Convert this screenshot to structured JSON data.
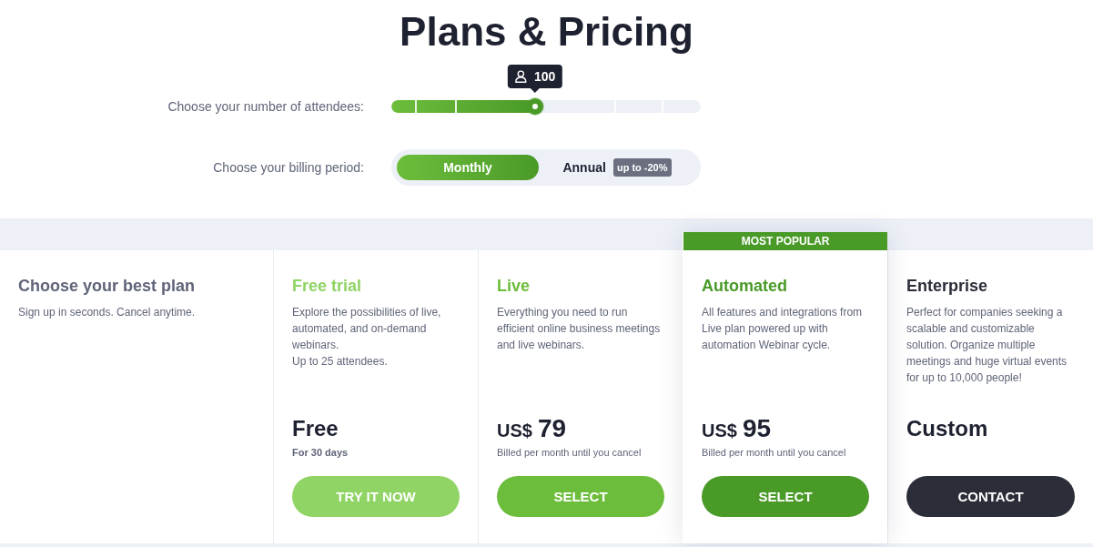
{
  "page": {
    "title": "Plans & Pricing"
  },
  "attendees": {
    "label": "Choose your number of attendees:",
    "level": 0.465,
    "value": "100"
  },
  "billing": {
    "label": "Choose your billing period:",
    "options": [
      {
        "label": "Monthly",
        "selected": true
      },
      {
        "label": "Annual",
        "selected": false,
        "badge": "up to -20%"
      }
    ]
  },
  "intro": {
    "title": "Choose your best plan",
    "subtitle": "Sign up in seconds. Cancel anytime."
  },
  "plans": [
    {
      "kind": "trial",
      "name": "Free trial",
      "color": "#8fd464",
      "featured": false,
      "description": "Explore the possibilities of live, automated, and on-demand webinars.\nUp to 25 attendees.",
      "amount": "Free",
      "note": "For 30 days",
      "button": "TRY IT NOW"
    },
    {
      "kind": "paid",
      "name": "Live",
      "color": "#6dbd3c",
      "featured": false,
      "description": "Everything you need to run efficient online business meetings and live webinars.",
      "currency": "US$",
      "amount": "79",
      "note": "Billed per month until you cancel",
      "button": "SELECT"
    },
    {
      "kind": "paid",
      "name": "Automated",
      "color": "#4a9a28",
      "featured": true,
      "ribbon": "MOST POPULAR",
      "description": "All features and integrations from Live plan powered up with automation Webinar cycle.",
      "currency": "US$",
      "amount": "95",
      "note": "Billed per month until you cancel",
      "button": "SELECT"
    },
    {
      "kind": "custom",
      "name": "Enterprise",
      "color": "#2b2e38",
      "featured": false,
      "description": "Perfect for companies seeking a scalable and customizable solution. Organize multiple meetings and huge virtual events for up to 10,000 people!",
      "amount": "Custom",
      "button": "CONTACT"
    }
  ]
}
